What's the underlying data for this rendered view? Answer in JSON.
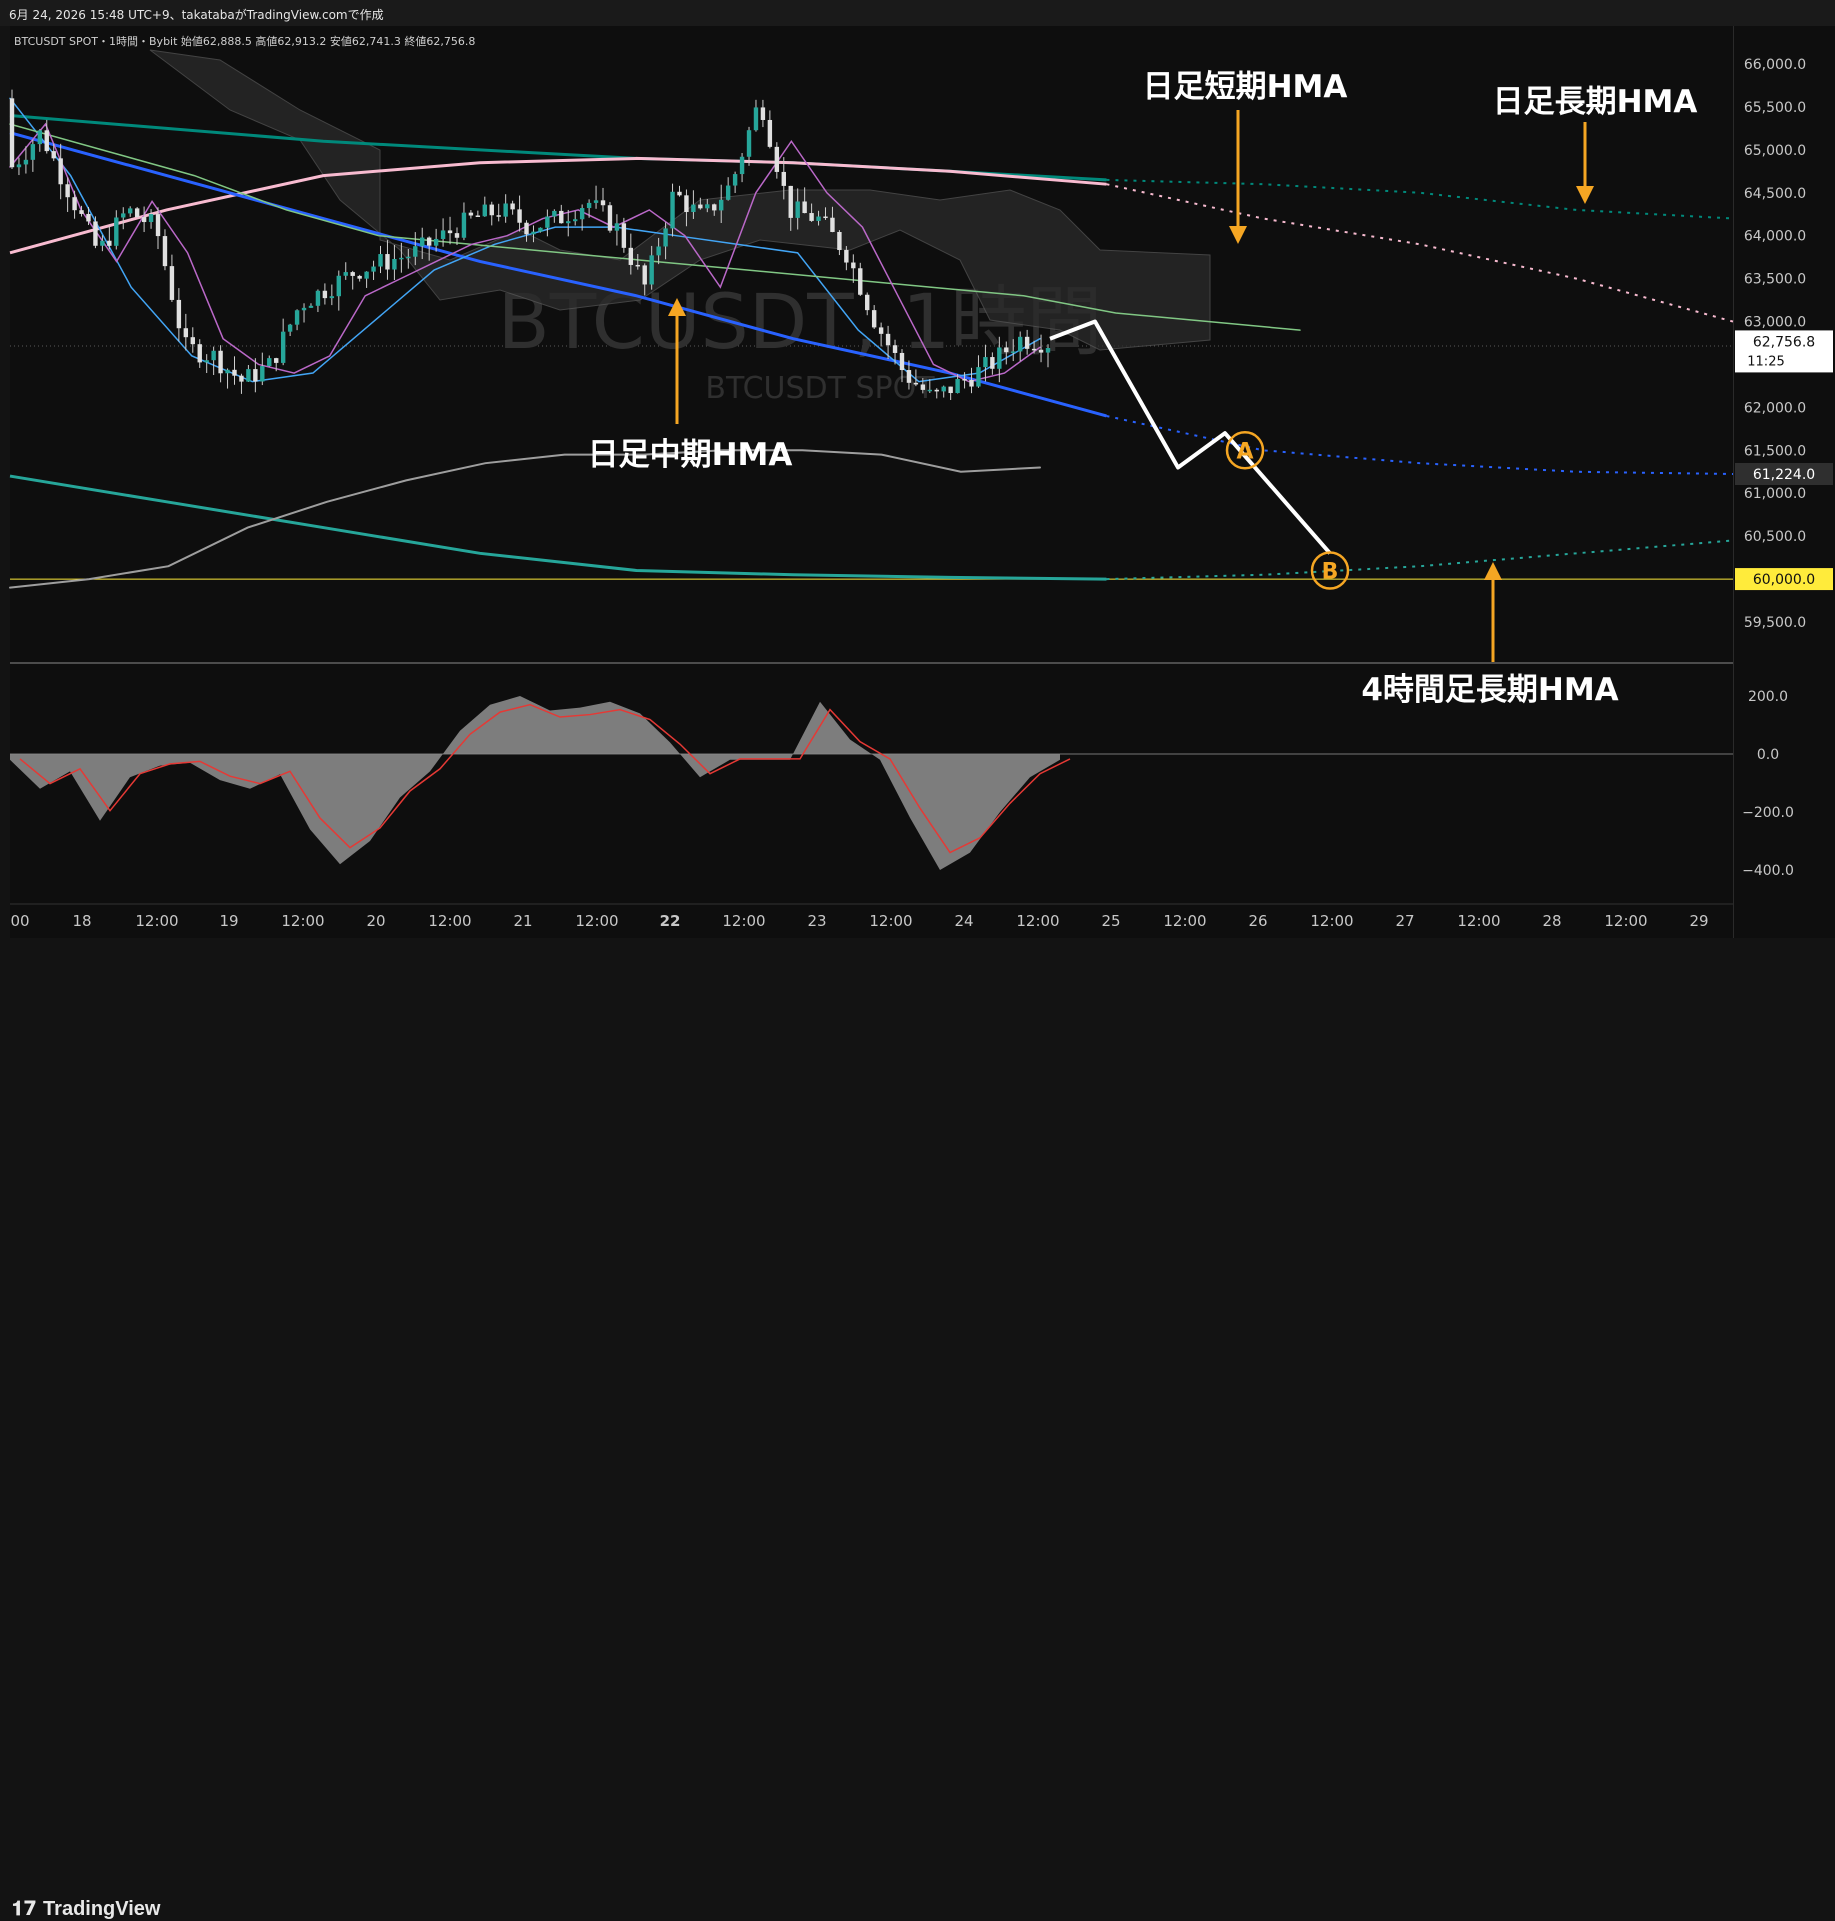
{
  "header": {
    "text": "6月 24, 2026 15:48 UTC+9、takatabaがTradingView.comで作成"
  },
  "legend": {
    "symbol": "BTCUSDT SPOT・1時間・Bybit",
    "open_label": "始値",
    "open": "62,888.5",
    "high_label": "高値",
    "high": "62,913.2",
    "low_label": "安値",
    "low": "62,741.3",
    "close_label": "終値",
    "close": "62,756.8"
  },
  "watermark": {
    "main": "BTCUSDT, 1時間",
    "sub": "BTCUSDT SPOT"
  },
  "annotations": [
    {
      "id": "daily-short-hma",
      "text": "日足短期HMA"
    },
    {
      "id": "daily-long-hma",
      "text": "日足長期HMA"
    },
    {
      "id": "daily-mid-hma",
      "text": "日足中期HMA"
    },
    {
      "id": "h4-long-hma",
      "text": "4時間足長期HMA"
    }
  ],
  "wave_labels": [
    "A",
    "B"
  ],
  "price_axis": {
    "ticks": [
      66000,
      65500,
      65000,
      64500,
      64000,
      63500,
      63000,
      62000,
      61500,
      61000,
      60500,
      59500
    ],
    "tick_labels": [
      "66,000.0",
      "65,500.0",
      "65,000.0",
      "64,500.0",
      "64,000.0",
      "63,500.0",
      "63,000.0",
      "62,000.0",
      "61,500.0",
      "61,000.0",
      "60,500.0",
      "59,500.0"
    ],
    "current_price": "62,756.8",
    "countdown": "11:25",
    "marker_blue": "61,224.0",
    "marker_level": "60,000.0"
  },
  "osc_axis": {
    "ticks": [
      200,
      0,
      -200,
      -400
    ],
    "tick_labels": [
      "200.0",
      "0.0",
      "−200.0",
      "−400.0"
    ]
  },
  "time_axis": {
    "labels": [
      "00",
      "18",
      "12:00",
      "19",
      "12:00",
      "20",
      "12:00",
      "21",
      "12:00",
      "22",
      "12:00",
      "23",
      "12:00",
      "24",
      "12:00",
      "25",
      "12:00",
      "26",
      "12:00",
      "27",
      "12:00",
      "28",
      "12:00",
      "29"
    ]
  },
  "colors": {
    "up": "#26a69a",
    "down": "#e0e0e0",
    "wick": "#cfcfcf",
    "hma_short": "#f8bbd0",
    "hma_mid": "#2962ff",
    "hma_long": "#00897b",
    "h4_long": "#26a69a",
    "h1_fast": "#ba68c8",
    "h1_mid": "#42a5f5",
    "h1_slow": "#81c784",
    "gray_line": "#9e9e9e",
    "level": "#ffeb3b",
    "annotation_arrow": "#f5a623",
    "projection": "#ffffff"
  },
  "brand": "TradingView",
  "chart_data": {
    "type": "line",
    "title": "BTCUSDT, 1時間",
    "ylim": [
      59200,
      66200
    ],
    "x_days": [
      "18",
      "19",
      "20",
      "21",
      "22",
      "23",
      "24",
      "25",
      "26",
      "27",
      "28",
      "29"
    ],
    "candles_close_path": [
      64800,
      65200,
      64500,
      63800,
      64300,
      64100,
      62700,
      62600,
      62300,
      62500,
      63200,
      63400,
      63600,
      63700,
      63800,
      64000,
      64200,
      64300,
      64100,
      64200,
      64400,
      64100,
      63400,
      64500,
      64200,
      64600,
      65600,
      64300,
      64200,
      63800,
      63000,
      62400,
      62100,
      62300,
      62500,
      62800,
      62757
    ],
    "series": [
      {
        "name": "日足短期HMA",
        "values": [
          63800,
          64300,
          64700,
          64850,
          64900,
          64850,
          64750,
          64600,
          64200,
          63900,
          63500,
          63000
        ]
      },
      {
        "name": "日足中期HMA",
        "values": [
          65200,
          64700,
          64200,
          63700,
          63300,
          62800,
          62400,
          61900,
          61500,
          61350,
          61250,
          61224
        ]
      },
      {
        "name": "日足長期HMA",
        "values": [
          65400,
          65250,
          65100,
          65000,
          64900,
          64850,
          64750,
          64650,
          64600,
          64500,
          64300,
          64200
        ]
      },
      {
        "name": "4時間足長期HMA",
        "values": [
          61200,
          60900,
          60600,
          60300,
          60100,
          60050,
          60020,
          60000,
          60050,
          60150,
          60300,
          60450
        ]
      }
    ],
    "projection": [
      62800,
      63000,
      61300,
      61700,
      60300
    ],
    "level": 60000
  }
}
